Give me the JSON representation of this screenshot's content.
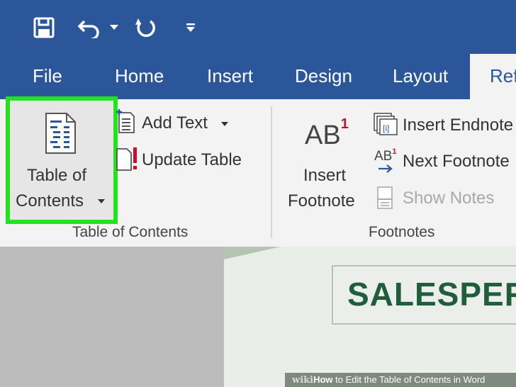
{
  "quick_access": {
    "icons": [
      "save-icon",
      "undo-icon",
      "dropdown-icon",
      "redo-icon",
      "customize-icon"
    ]
  },
  "tabs": [
    "File",
    "Home",
    "Insert",
    "Design",
    "Layout",
    "Ref"
  ],
  "ribbon": {
    "toc_group": {
      "toc_button_line1": "Table of",
      "toc_button_line2": "Contents",
      "add_text": "Add Text",
      "update_table": "Update Table",
      "group_label": "Table of Contents"
    },
    "footnotes_group": {
      "insert_footnote_line1": "Insert",
      "insert_footnote_line2": "Footnote",
      "insert_footnote_icon_text": "AB",
      "insert_footnote_superscript": "1",
      "insert_endnote": "Insert Endnote",
      "next_footnote": "Next Footnote",
      "next_footnote_icon_text": "AB",
      "next_footnote_superscript": "1",
      "show_notes": "Show Notes",
      "group_label": "Footnotes"
    }
  },
  "document": {
    "title": "SALESPER"
  },
  "watermark": {
    "brand": "wiki",
    "text_bold": "How",
    "text": " to Edit the Table of Contents in Word"
  },
  "colors": {
    "accent": "#2b579a",
    "highlight": "#22e31c",
    "doc_title": "#1e5e3a",
    "footnote_red": "#c8102e"
  }
}
